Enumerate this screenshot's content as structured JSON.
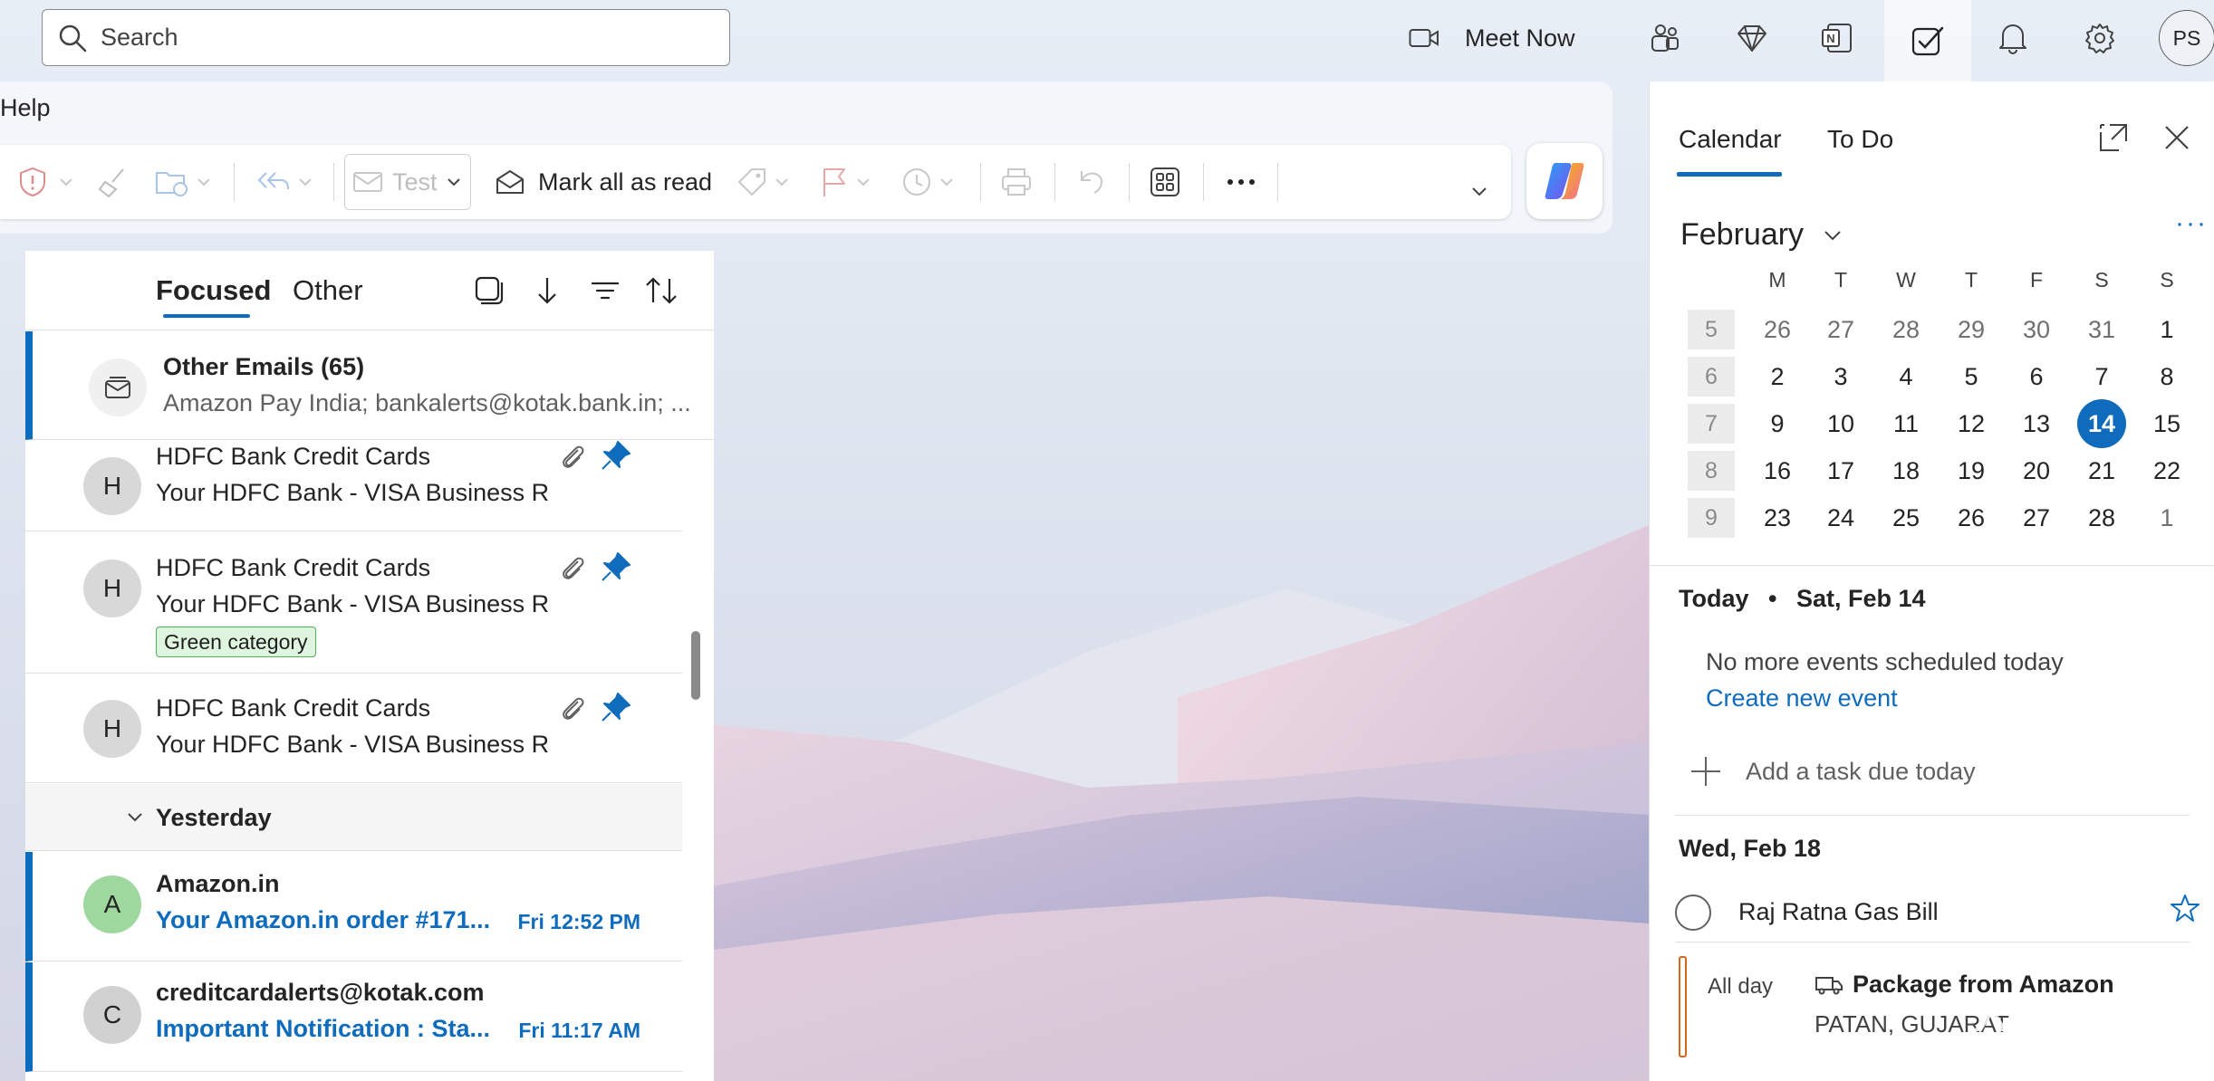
{
  "topbar": {
    "search_placeholder": "Search",
    "meet_now": "Meet Now",
    "avatar_initials": "PS",
    "icons": [
      "video-camera-icon",
      "teams-icon",
      "premium-diamond-icon",
      "onenote-icon",
      "todo-icon",
      "bell-icon",
      "gear-icon"
    ]
  },
  "ribbon": {
    "help": "Help",
    "test_label": "Test",
    "mark_all_read": "Mark all as read"
  },
  "mail": {
    "tabs": {
      "focused": "Focused",
      "other": "Other"
    },
    "other_emails": {
      "title": "Other Emails (65)",
      "senders": "Amazon Pay India; bankalerts@kotak.bank.in; ..."
    },
    "items": [
      {
        "avatar": "H",
        "from": "HDFC Bank Credit Cards",
        "subject": "Your HDFC Bank - VISA Business R"
      },
      {
        "avatar": "H",
        "from": "HDFC Bank Credit Cards",
        "subject": "Your HDFC Bank - VISA Business R",
        "category": "Green category"
      },
      {
        "avatar": "H",
        "from": "HDFC Bank Credit Cards",
        "subject": "Your HDFC Bank - VISA Business R"
      }
    ],
    "group_yesterday": "Yesterday",
    "unread": [
      {
        "avatar": "A",
        "from": "Amazon.in",
        "subject": "Your Amazon.in order #171...",
        "time": "Fri 12:52 PM",
        "avatar_color": "#9fd89f"
      },
      {
        "avatar": "C",
        "from": "creditcardalerts@kotak.com",
        "subject": "Important Notification : Sta...",
        "time": "Fri 11:17 AM",
        "avatar_color": "#d1d1d1"
      }
    ]
  },
  "calendar": {
    "tab_calendar": "Calendar",
    "tab_todo": "To Do",
    "month": "February",
    "days_of_week": [
      "M",
      "T",
      "W",
      "T",
      "F",
      "S",
      "S"
    ],
    "weeks": [
      {
        "num": "5",
        "days": [
          "26",
          "27",
          "28",
          "29",
          "30",
          "31",
          "1"
        ]
      },
      {
        "num": "6",
        "days": [
          "2",
          "3",
          "4",
          "5",
          "6",
          "7",
          "8"
        ]
      },
      {
        "num": "7",
        "days": [
          "9",
          "10",
          "11",
          "12",
          "13",
          "14",
          "15"
        ]
      },
      {
        "num": "8",
        "days": [
          "16",
          "17",
          "18",
          "19",
          "20",
          "21",
          "22"
        ]
      },
      {
        "num": "9",
        "days": [
          "23",
          "24",
          "25",
          "26",
          "27",
          "28",
          "1"
        ]
      }
    ],
    "today_label": "Today",
    "today_date": "Sat, Feb 14",
    "no_events": "No more events scheduled today",
    "create_event": "Create new event",
    "add_task": "Add a task due today",
    "upcoming_date": "Wed, Feb 18",
    "task": "Raj Ratna Gas Bill",
    "event": {
      "when": "All day",
      "title": "Package from Amazon",
      "location": "PATAN, GUJARAT"
    }
  },
  "colors": {
    "accent": "#0f6cbd",
    "category_green": "#54b054"
  },
  "watermark": "XDR"
}
